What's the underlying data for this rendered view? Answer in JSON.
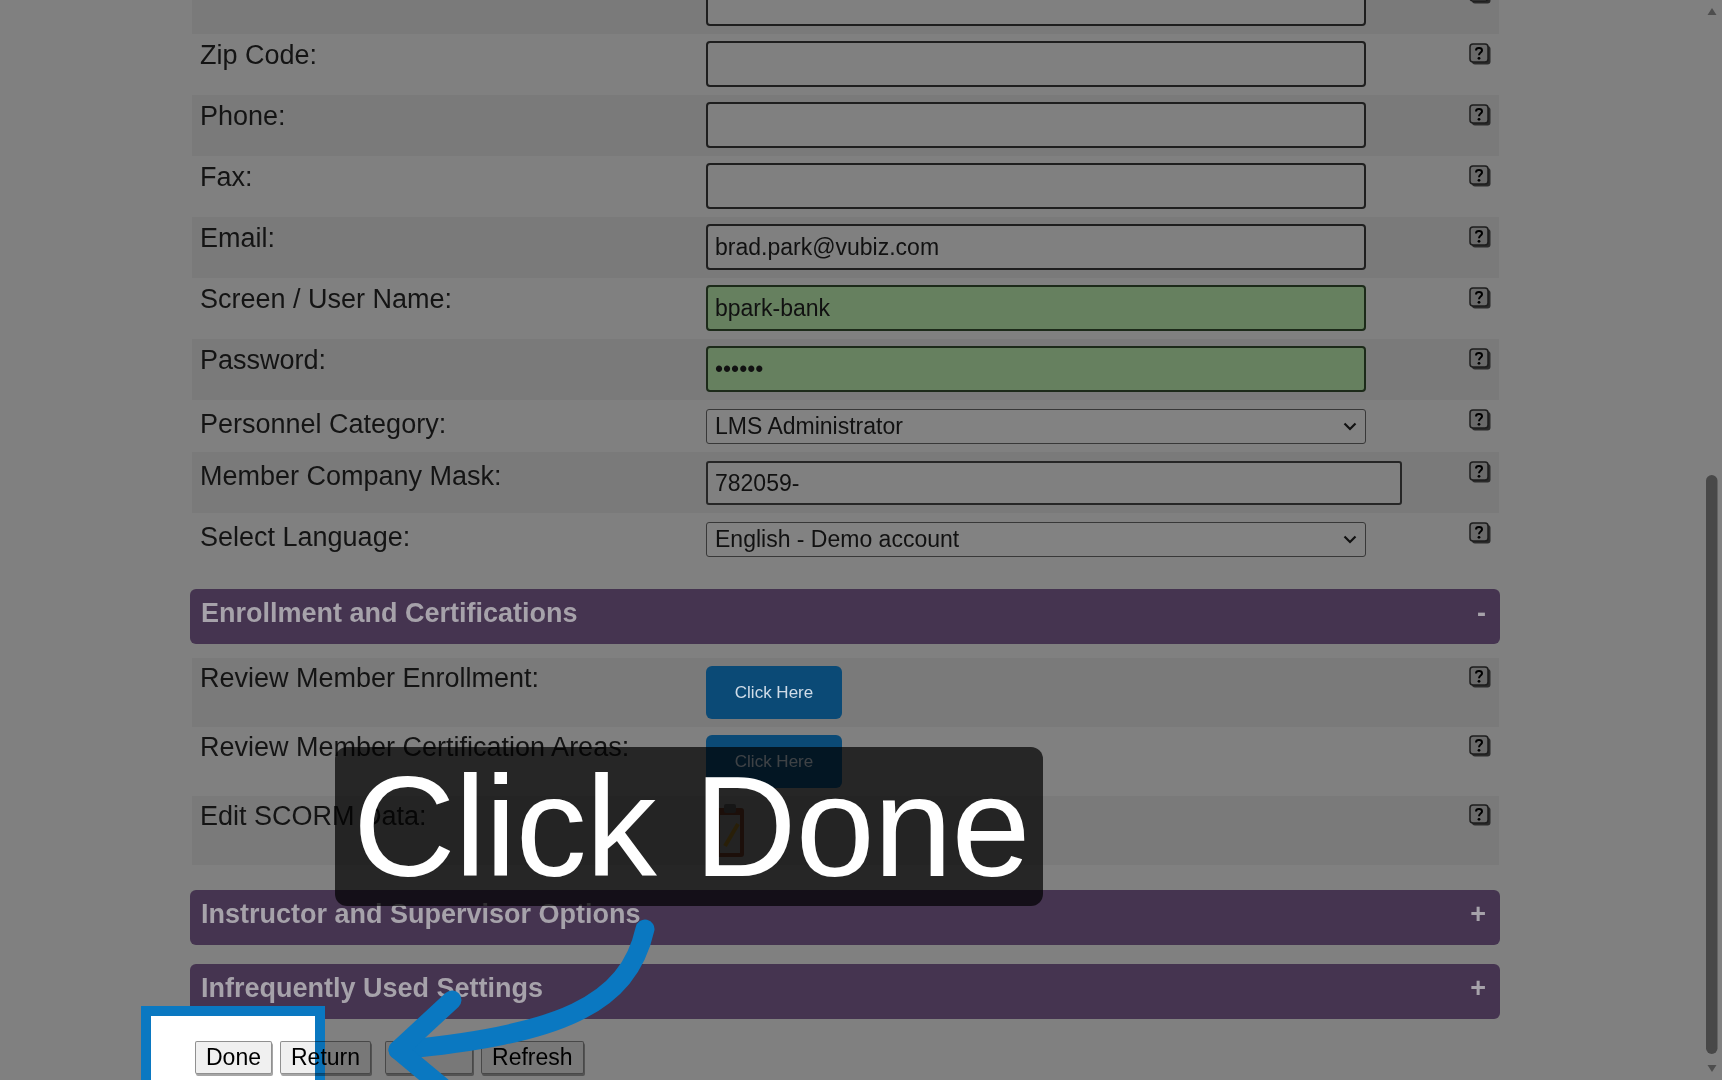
{
  "profile_rows": [
    {
      "kind": "text",
      "autofilled": false
    },
    {
      "kind": "text",
      "label": "Zip Code:",
      "autofilled": false
    },
    {
      "kind": "text",
      "label": "Phone:",
      "autofilled": false
    },
    {
      "kind": "text",
      "label": "Fax:",
      "autofilled": false
    },
    {
      "kind": "text",
      "label": "Email:",
      "value": "brad.park@vubiz.com",
      "autofilled": false
    },
    {
      "kind": "text",
      "label": "Screen / User Name:",
      "value": "bpark-bank",
      "autofilled": true
    },
    {
      "kind": "text",
      "label": "Password:",
      "value": "••••••",
      "autofilled": true
    },
    {
      "kind": "select",
      "label": "Personnel Category:",
      "value": "LMS Administrator"
    },
    {
      "kind": "wide",
      "label": "Member Company Mask:",
      "value": "782059-",
      "autofilled": false
    },
    {
      "kind": "select",
      "label": "Select Language:",
      "value": "English - Demo account"
    }
  ],
  "sections": [
    {
      "title": "Enrollment and Certifications",
      "toggle": "-",
      "rows": [
        {
          "kind": "button",
          "label": "Review Member Enrollment:",
          "button": "Click Here"
        },
        {
          "kind": "button",
          "label": "Review Member Certification Areas:",
          "button": "Click Here"
        },
        {
          "kind": "icon",
          "label": "Edit SCORM Data:"
        }
      ]
    },
    {
      "title": "Instructor and Supervisor Options",
      "toggle": "+"
    },
    {
      "title": "Infrequently Used Settings",
      "toggle": "+"
    }
  ],
  "buttons": [
    {
      "kind": "label",
      "label": "Done",
      "highlighted": true
    },
    {
      "kind": "label",
      "label": "Return",
      "highlighted": false
    },
    {
      "kind": "blank",
      "highlighted": false
    },
    {
      "kind": "label",
      "label": "Refresh",
      "highlighted": false
    }
  ],
  "tutorial": {
    "caption": "Click Done"
  }
}
